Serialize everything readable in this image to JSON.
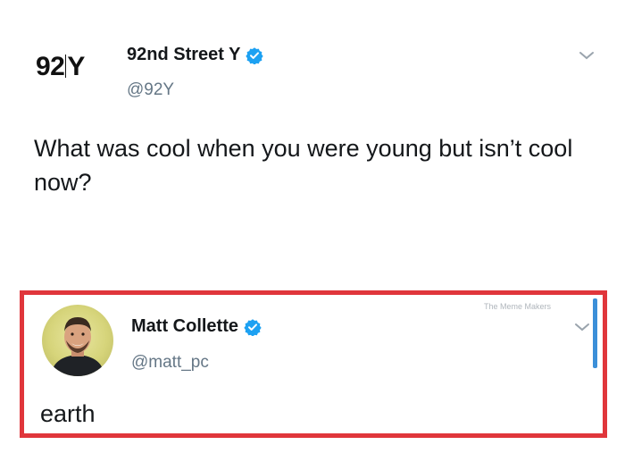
{
  "main_tweet": {
    "logo_text": "92Y",
    "display_name": "92nd Street Y",
    "handle": "@92Y",
    "text": "What was cool when you were young but isn’t cool now?",
    "verified_icon": "verified-badge-icon",
    "menu_icon": "chevron-down-icon"
  },
  "reply_tweet": {
    "display_name": "Matt Collette",
    "handle": "@matt_pc",
    "text": "earth",
    "watermark": "The Meme Makers",
    "verified_icon": "verified-badge-icon",
    "menu_icon": "chevron-down-icon"
  },
  "colors": {
    "highlight_border": "#e0363b",
    "verified_blue": "#1da1f2",
    "handle_gray": "#657786",
    "scroll_blue": "#3b8fd8"
  }
}
